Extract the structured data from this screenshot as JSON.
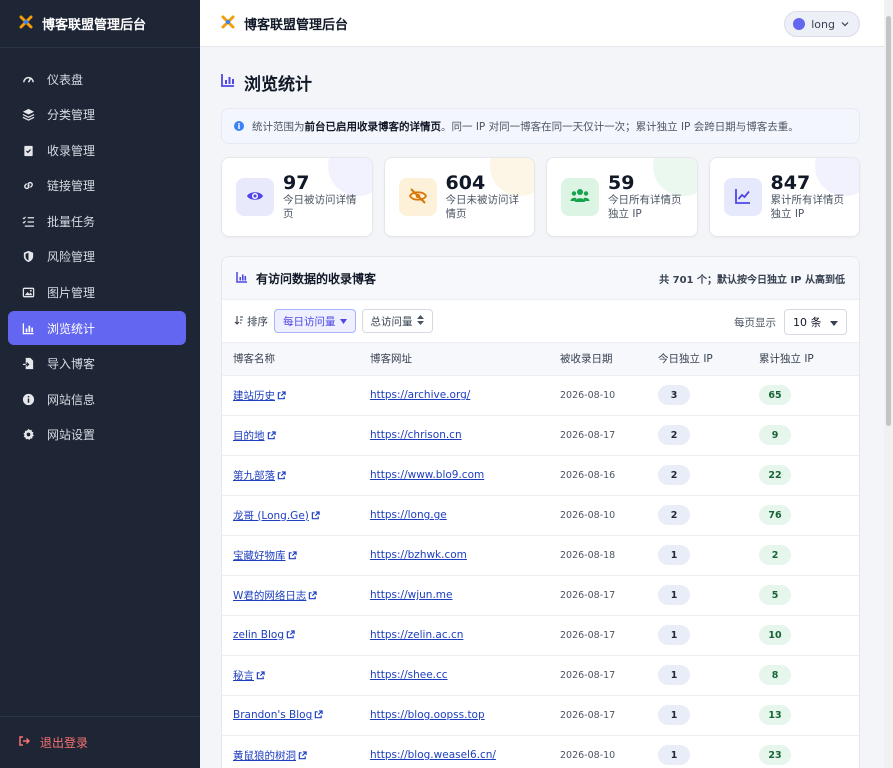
{
  "app": {
    "title": "博客联盟管理后台"
  },
  "sidebar": {
    "items": [
      {
        "label": "仪表盘",
        "icon": "dashboard-icon"
      },
      {
        "label": "分类管理",
        "icon": "layers-icon"
      },
      {
        "label": "收录管理",
        "icon": "clipboard-check-icon"
      },
      {
        "label": "链接管理",
        "icon": "link-icon"
      },
      {
        "label": "批量任务",
        "icon": "list-check-icon"
      },
      {
        "label": "风险管理",
        "icon": "shield-icon"
      },
      {
        "label": "图片管理",
        "icon": "image-icon"
      },
      {
        "label": "浏览统计",
        "icon": "bar-chart-icon",
        "active": true
      },
      {
        "label": "导入博客",
        "icon": "file-import-icon"
      },
      {
        "label": "网站信息",
        "icon": "info-icon"
      },
      {
        "label": "网站设置",
        "icon": "gear-icon"
      }
    ],
    "logout": "退出登录"
  },
  "topbar": {
    "title": "博客联盟管理后台",
    "user": "long"
  },
  "page": {
    "title": "浏览统计"
  },
  "notice": {
    "prefix": "统计范围为",
    "bold": "前台已启用收录博客的详情页",
    "suffix": "。同一 IP 对同一博客在同一天仅计一次；累计独立 IP 会跨日期与博客去重。"
  },
  "stats": [
    {
      "value": "97",
      "label": "今日被访问详情页",
      "icon": "eye-icon",
      "color": "#4f46e5",
      "bg": "#e8eafc",
      "blob": "#f1f2fd"
    },
    {
      "value": "604",
      "label": "今日未被访问详情页",
      "icon": "eye-slash-icon",
      "color": "#d97706",
      "bg": "#fdf1d9",
      "blob": "#fdf5e6"
    },
    {
      "value": "59",
      "label": "今日所有详情页独立 IP",
      "icon": "users-icon",
      "color": "#16a34a",
      "bg": "#dcf4e4",
      "blob": "#eaf8ef"
    },
    {
      "value": "847",
      "label": "累计所有详情页独立 IP",
      "icon": "line-chart-icon",
      "color": "#4f46e5",
      "bg": "#e5e9fb",
      "blob": "#f1f2fd"
    }
  ],
  "panel": {
    "title": "有访问数据的收录博客",
    "note": "共 701 个；默认按今日独立 IP 从高到低",
    "sort_label": "排序",
    "sort_daily": "每日访问量",
    "sort_total": "总访问量",
    "per_page_label": "每页显示",
    "per_page_value": "10 条",
    "columns": [
      "博客名称",
      "博客网址",
      "被收录日期",
      "今日独立 IP",
      "累计独立 IP"
    ],
    "rows": [
      {
        "name": "建站历史",
        "url": "https://archive.org/",
        "date": "2026-08-10",
        "today": "3",
        "total": "65"
      },
      {
        "name": "目的地",
        "url": "https://chrison.cn",
        "date": "2026-08-17",
        "today": "2",
        "total": "9"
      },
      {
        "name": "第九部落",
        "url": "https://www.blo9.com",
        "date": "2026-08-16",
        "today": "2",
        "total": "22"
      },
      {
        "name": "龙哥 (Long.Ge)",
        "url": "https://long.ge",
        "date": "2026-08-10",
        "today": "2",
        "total": "76"
      },
      {
        "name": "宝藏好物库",
        "url": "https://bzhwk.com",
        "date": "2026-08-18",
        "today": "1",
        "total": "2"
      },
      {
        "name": "W君的网络日志",
        "url": "https://wjun.me",
        "date": "2026-08-17",
        "today": "1",
        "total": "5"
      },
      {
        "name": "zelin Blog",
        "url": "https://zelin.ac.cn",
        "date": "2026-08-17",
        "today": "1",
        "total": "10"
      },
      {
        "name": "秘言",
        "url": "https://shee.cc",
        "date": "2026-08-17",
        "today": "1",
        "total": "8"
      },
      {
        "name": "Brandon's Blog",
        "url": "https://blog.oopss.top",
        "date": "2026-08-17",
        "today": "1",
        "total": "13"
      },
      {
        "name": "黄鼠狼的树洞",
        "url": "https://blog.weasel6.cn/",
        "date": "2026-08-10",
        "today": "1",
        "total": "23"
      }
    ]
  }
}
